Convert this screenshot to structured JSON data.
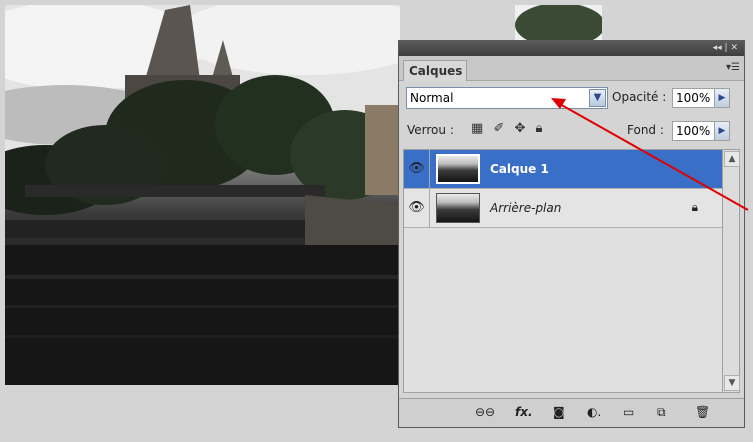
{
  "panel": {
    "title_controls": "◂◂ | ✕",
    "tab_label": "Calques",
    "menu_icon": "panel-menu-icon",
    "blend_mode": "Normal",
    "opacity_label": "Opacité :",
    "opacity_value": "100%",
    "lock_label": "Verrou :",
    "fill_label": "Fond :",
    "fill_value": "100%",
    "layers": [
      {
        "name": "Calque 1",
        "selected": true
      },
      {
        "name": "Arrière-plan",
        "selected": false,
        "locked": true
      }
    ]
  },
  "colors": {
    "selection": "#3a6fc7",
    "annotation_arrow": "#e00000"
  }
}
